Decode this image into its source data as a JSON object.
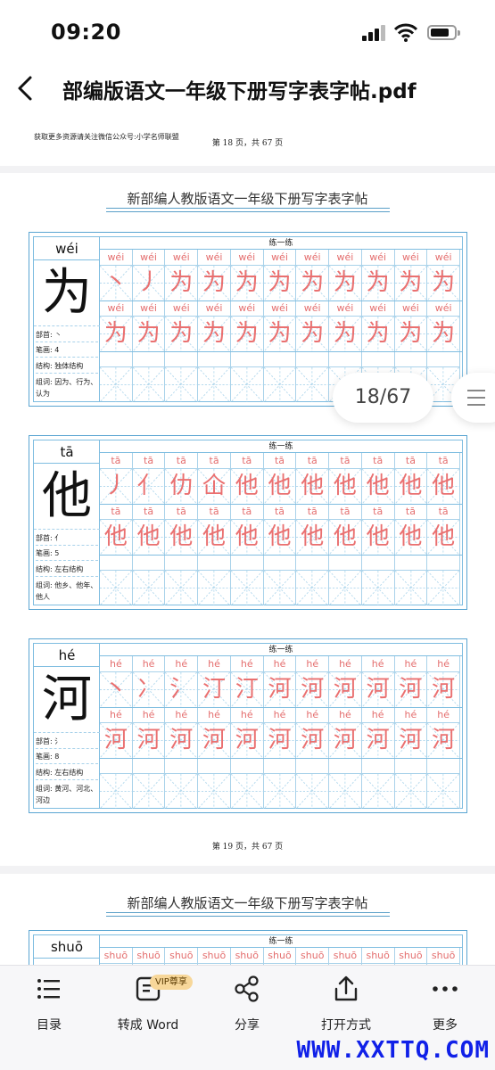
{
  "status": {
    "time": "09:20"
  },
  "nav": {
    "title": "部编版语文一年级下册写字表字帖.pdf"
  },
  "doc": {
    "header_note": "获取更多资源请关注微信公众号:小学名师联盟",
    "sheet_title": "新部编人教版语文一年级下册写字表字帖",
    "practice_label": "练一练",
    "page18": "第 18 页，共 67 页",
    "page19": "第 19 页，共 67 页",
    "cards": [
      {
        "pinyin": "wéi",
        "char": "为",
        "radical": "部首: 丶",
        "strokes": "笔画: 4",
        "structure": "结构: 独体结构",
        "words": "组词: 因为、行为、认为",
        "row1": [
          "丶",
          "丿",
          "为",
          "为",
          "为",
          "为",
          "为",
          "为",
          "为",
          "为",
          "为"
        ],
        "row2": [
          "为",
          "为",
          "为",
          "为",
          "为",
          "为",
          "为",
          "为",
          "为",
          "为",
          "为"
        ]
      },
      {
        "pinyin": "tā",
        "char": "他",
        "radical": "部首: 亻",
        "strokes": "笔画: 5",
        "structure": "结构: 左右结构",
        "words": "组词: 他乡、他年、他人",
        "row1": [
          "丿",
          "亻",
          "仂",
          "仚",
          "他",
          "他",
          "他",
          "他",
          "他",
          "他",
          "他"
        ],
        "row2": [
          "他",
          "他",
          "他",
          "他",
          "他",
          "他",
          "他",
          "他",
          "他",
          "他",
          "他"
        ]
      },
      {
        "pinyin": "hé",
        "char": "河",
        "radical": "部首: 氵",
        "strokes": "笔画: 8",
        "structure": "结构: 左右结构",
        "words": "组词: 黄河、河北、河边",
        "row1": [
          "丶",
          "冫",
          "氵",
          "汀",
          "汀",
          "河",
          "河",
          "河",
          "河",
          "河",
          "河"
        ],
        "row2": [
          "河",
          "河",
          "河",
          "河",
          "河",
          "河",
          "河",
          "河",
          "河",
          "河",
          "河"
        ]
      }
    ],
    "next_pinyin": "shuō"
  },
  "page_indicator": "18/67",
  "toolbar": {
    "items": [
      {
        "label": "目录",
        "icon": "list-icon"
      },
      {
        "label": "转成 Word",
        "icon": "convert-word-icon"
      },
      {
        "label": "分享",
        "icon": "share-icon"
      },
      {
        "label": "打开方式",
        "icon": "open-with-icon"
      },
      {
        "label": "更多",
        "icon": "more-icon"
      }
    ],
    "vip_badge": "VIP尊享"
  },
  "watermark": "WWW.XXTTQ.COM",
  "colors": {
    "accent": "#5aa5d2",
    "practice_red": "#ea7070",
    "watermark": "#1020e8"
  }
}
